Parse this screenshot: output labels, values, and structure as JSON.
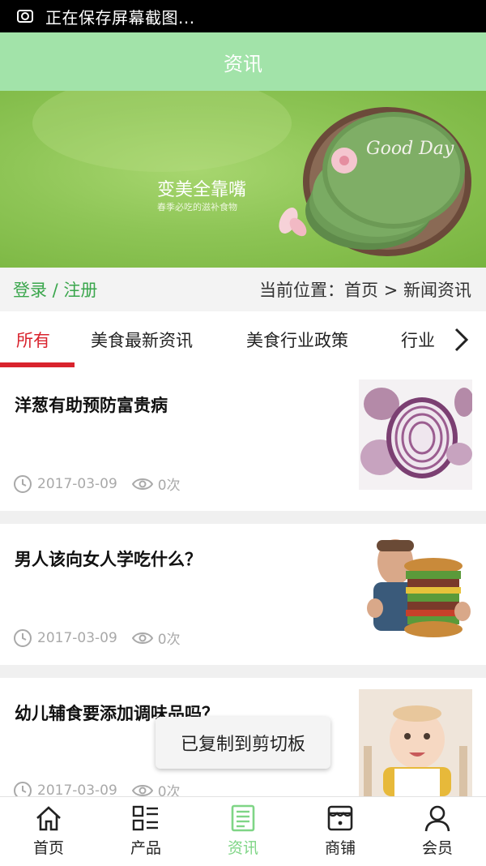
{
  "status_bar": {
    "text": "正在保存屏幕截图..."
  },
  "header": {
    "title": "资讯"
  },
  "banner": {
    "headline": "变美全靠嘴",
    "subline": "春季必吃的滋补食物",
    "plate_text": "Good Day"
  },
  "location_bar": {
    "login": "登录 / 注册",
    "breadcrumb": "当前位置：首页 > 新闻资讯"
  },
  "tabs": [
    {
      "label": "所有",
      "active": true
    },
    {
      "label": "美食最新资讯",
      "active": false
    },
    {
      "label": "美食行业政策",
      "active": false
    },
    {
      "label": "行业",
      "active": false
    }
  ],
  "articles": [
    {
      "title": "洋葱有助预防富贵病",
      "date": "2017-03-09",
      "views": "0次",
      "image": "onion"
    },
    {
      "title": "男人该向女人学吃什么？",
      "date": "2017-03-09",
      "views": "0次",
      "image": "man-burger"
    },
    {
      "title": "幼儿辅食要添加调味品吗？",
      "date": "2017-03-09",
      "views": "0次",
      "image": "baby"
    }
  ],
  "toast": {
    "text": "已复制到剪切板"
  },
  "bottom_nav": [
    {
      "label": "首页",
      "icon": "home-icon"
    },
    {
      "label": "产品",
      "icon": "grid-list-icon"
    },
    {
      "label": "资讯",
      "icon": "news-icon",
      "active": true
    },
    {
      "label": "商铺",
      "icon": "shop-icon"
    },
    {
      "label": "会员",
      "icon": "user-icon"
    }
  ],
  "colors": {
    "header_bg": "#a2e3a9",
    "accent_red": "#d9232d",
    "login_green": "#3aa64c",
    "nav_active": "#7fd586"
  }
}
